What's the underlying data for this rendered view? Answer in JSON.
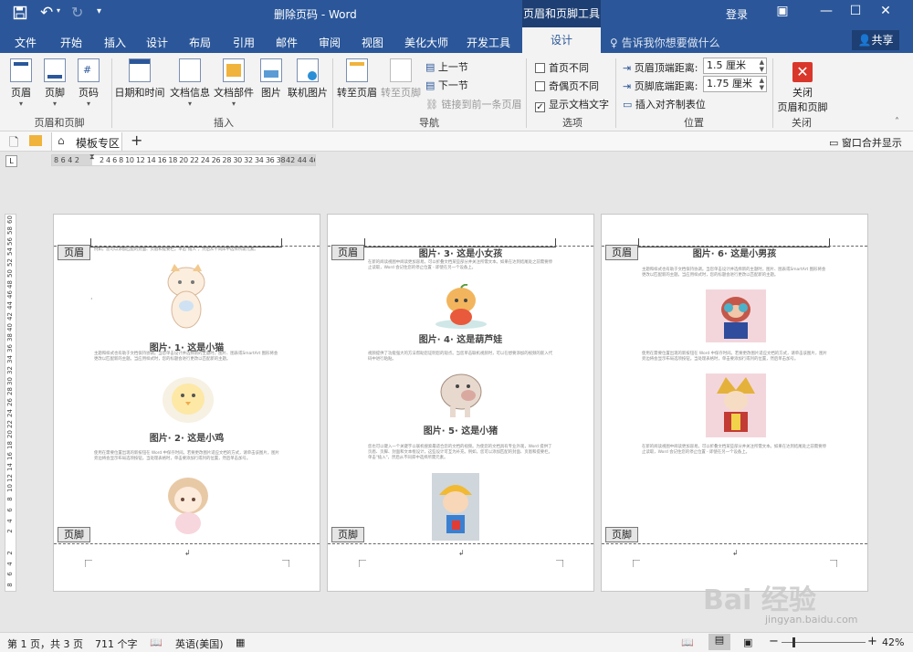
{
  "titlebar": {
    "doc_title": "删除页码 - Word",
    "tools_label": "页眉和页脚工具",
    "login": "登录"
  },
  "tabs": [
    "文件",
    "开始",
    "插入",
    "设计",
    "布局",
    "引用",
    "邮件",
    "审阅",
    "视图",
    "美化大师",
    "开发工具"
  ],
  "active_tab": "设计",
  "tellme": "告诉我你想要做什么",
  "share": "共享",
  "ribbon": {
    "groups": {
      "header_footer": "页眉和页脚",
      "insert": "插入",
      "nav": "导航",
      "options": "选项",
      "position": "位置",
      "close": "关闭"
    },
    "header_btn": "页眉",
    "footer_btn": "页脚",
    "pagenum_btn": "页码",
    "datetime_btn": "日期和时间",
    "docinfo_btn": "文档信息",
    "docparts_btn": "文档部件",
    "picture_btn": "图片",
    "onlinepic_btn": "联机图片",
    "goto_header": "转至页眉",
    "goto_footer": "转至页脚",
    "prev": "上一节",
    "next": "下一节",
    "link_prev": "链接到前一条页眉",
    "diff_first": "首页不同",
    "diff_oddeven": "奇偶页不同",
    "show_text": "显示文档文字",
    "header_dist_label": "页眉顶端距离:",
    "header_dist_value": "1.5 厘米",
    "footer_dist_label": "页脚底端距离:",
    "footer_dist_value": "1.75 厘米",
    "insert_align_tab": "插入对齐制表位",
    "close_line1": "关闭",
    "close_line2": "页眉和页脚"
  },
  "template_bar": {
    "tab_label": "模板专区",
    "plus": "+",
    "right_label": "窗口合并显示"
  },
  "rulers": {
    "corner": "L",
    "h_left": "8 6 4 2",
    "h_main": "2 4 6 8 10 12 14 16 18 20 22 24 26 28 30 32 34 36 38",
    "h_right": "42 44 46",
    "v_labels": [
      "60",
      "58",
      "56",
      "54",
      "52",
      "50",
      "48",
      "46",
      "44",
      "42",
      "40",
      "38",
      "36",
      "34",
      "32",
      "30",
      "28",
      "26",
      "24",
      "22",
      "20",
      "18",
      "16",
      "14",
      "12",
      "10",
      "8",
      "6",
      "4",
      "2",
      "",
      "2",
      "4",
      "6",
      "8"
    ]
  },
  "pages": [
    {
      "header_tag": "页眉",
      "footer_tag": "页脚",
      "top_text": "例如，您可以添加匹配的封面、页眉和提要栏。单击\"插入\"，然后从不同库中选择所需元素。",
      "caption1": "图片· 1· 这是小猫",
      "text1": "主题和样式也有助于文档保持协调。当您单击设计并选择新的主题时，图片、图表或SmartArt 图形将会更改以匹配新的主题。当应用样式时，您的标题会进行更改以匹配新的主题。",
      "caption2": "图片· 2· 这是小鸡",
      "text2": "使用在需要位置出现的新按钮在 Word 中保存时间。若要更改图片适应文档的方式，请单击该图片，图片旁边将会显示布局选项按钮。当处理表格时，单击要添加行或列的位置，然后单击加号。"
    },
    {
      "header_tag": "页眉",
      "footer_tag": "页脚",
      "caption_top": "图片· 3· 这是小女孩",
      "text_top": "在新的阅读视图中阅读更加容易。可以折叠文档某些部分并关注所需文本。如果在达到结尾处之前需要停止读取，Word 会记住您的停止位置 - 即使在另一个设备上。",
      "caption1": "图片· 4· 这是葫芦娃",
      "text1": "视频提供了功能强大的方法帮助您证明您的观点。当您单击联机视频时，可以在想要添加的视频的嵌入代码中进行粘贴。",
      "caption2": "图片· 5· 这是小猪",
      "text2": "您也可以键入一个关键字以联机搜索最适合您的文档的视频。为使您的文档具有专业外观，Word 提供了页眉、页脚、封面和文本框设计，这些设计可互为补充。例如，您可以添加匹配的封面、页眉和提要栏。单击\"插入\"，然后从不同库中选择所需元素。"
    },
    {
      "header_tag": "页眉",
      "footer_tag": "页脚",
      "caption_top": "图片· 6· 这是小男孩",
      "text1": "主题和样式也有助于文档保持协调。当您单击设计并选择新的主题时，图片、图表或SmartArt 图形将会更改以匹配新的主题。当应用样式时，您的标题会进行更改以匹配新的主题。",
      "text2": "使用在需要位置出现的新按钮在 Word 中保存时间。若要更改图片适应文档的方式，请单击该图片，图片旁边将会显示布局选项按钮。当处理表格时，单击要添加行或列的位置，然后单击加号。",
      "text3": "在新的阅读视图中阅读更加容易。可以折叠文档某些部分并关注所需文本。如果在达到结尾处之前需要停止读取，Word 会记住您的停止位置 - 即使在另一个设备上。"
    }
  ],
  "status": {
    "page": "第 1 页，共 3 页",
    "words": "711 个字",
    "lang": "英语(美国)",
    "zoom": "42%",
    "minus": "−",
    "plus": "+"
  },
  "watermark": {
    "main": "Bai 经验",
    "sub": "jingyan.baidu.com"
  },
  "colors": {
    "word_blue": "#2b579a",
    "close_red": "#d9372b"
  }
}
